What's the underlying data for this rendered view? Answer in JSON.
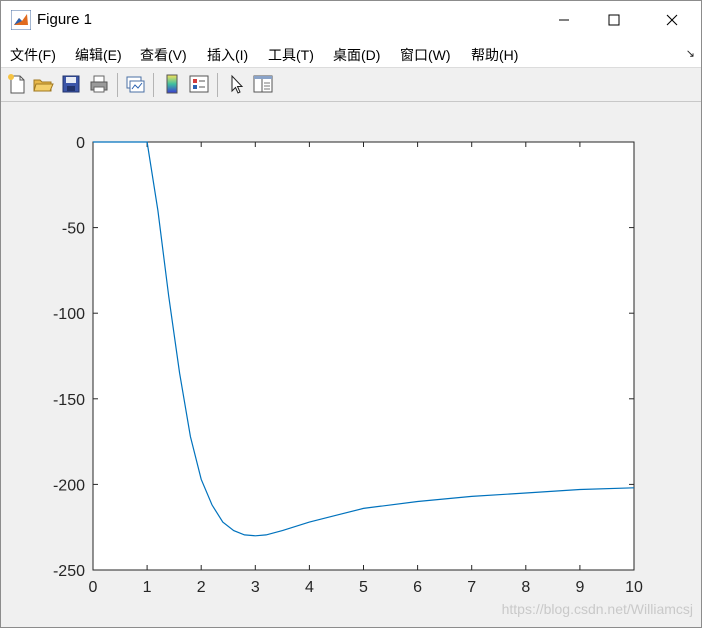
{
  "window": {
    "title": "Figure 1",
    "controls": {
      "minimize": "—",
      "maximize": "☐",
      "close": "✕"
    }
  },
  "menu": {
    "items": [
      {
        "label": "文件(F)"
      },
      {
        "label": "编辑(E)"
      },
      {
        "label": "查看(V)"
      },
      {
        "label": "插入(I)"
      },
      {
        "label": "工具(T)"
      },
      {
        "label": "桌面(D)"
      },
      {
        "label": "窗口(W)"
      },
      {
        "label": "帮助(H)"
      }
    ],
    "dock_arrow": "↘"
  },
  "toolbar": {
    "buttons": [
      {
        "icon": "new-figure-icon"
      },
      {
        "icon": "open-file-icon"
      },
      {
        "icon": "save-icon"
      },
      {
        "icon": "print-icon"
      },
      {
        "icon": "link-plot-icon"
      },
      {
        "icon": "colorbar-icon"
      },
      {
        "icon": "legend-icon"
      },
      {
        "icon": "pointer-icon"
      },
      {
        "icon": "property-editor-icon"
      }
    ]
  },
  "watermark": "https://blog.csdn.net/Williamcsj",
  "chart_data": {
    "type": "line",
    "title": "",
    "xlabel": "",
    "ylabel": "",
    "xlim": [
      0,
      10
    ],
    "ylim": [
      -250,
      0
    ],
    "xticks": [
      "0",
      "1",
      "2",
      "3",
      "4",
      "5",
      "6",
      "7",
      "8",
      "9",
      "10"
    ],
    "yticks": [
      "0",
      "-50",
      "-100",
      "-150",
      "-200",
      "-250"
    ],
    "grid": false,
    "line_color": "#0072bd",
    "series": [
      {
        "x": [
          0,
          1,
          1.2,
          1.4,
          1.6,
          1.8,
          2.0,
          2.2,
          2.4,
          2.6,
          2.8,
          3.0,
          3.2,
          3.5,
          4.0,
          4.5,
          5.0,
          6.0,
          7.0,
          8.0,
          9.0,
          10.0
        ],
        "y": [
          0,
          0,
          -40,
          -90,
          -135,
          -172,
          -197,
          -212,
          -222,
          -227,
          -229.5,
          -230,
          -229.5,
          -227,
          -222,
          -218,
          -214,
          -210,
          -207,
          -205,
          -203,
          -202
        ]
      }
    ]
  }
}
